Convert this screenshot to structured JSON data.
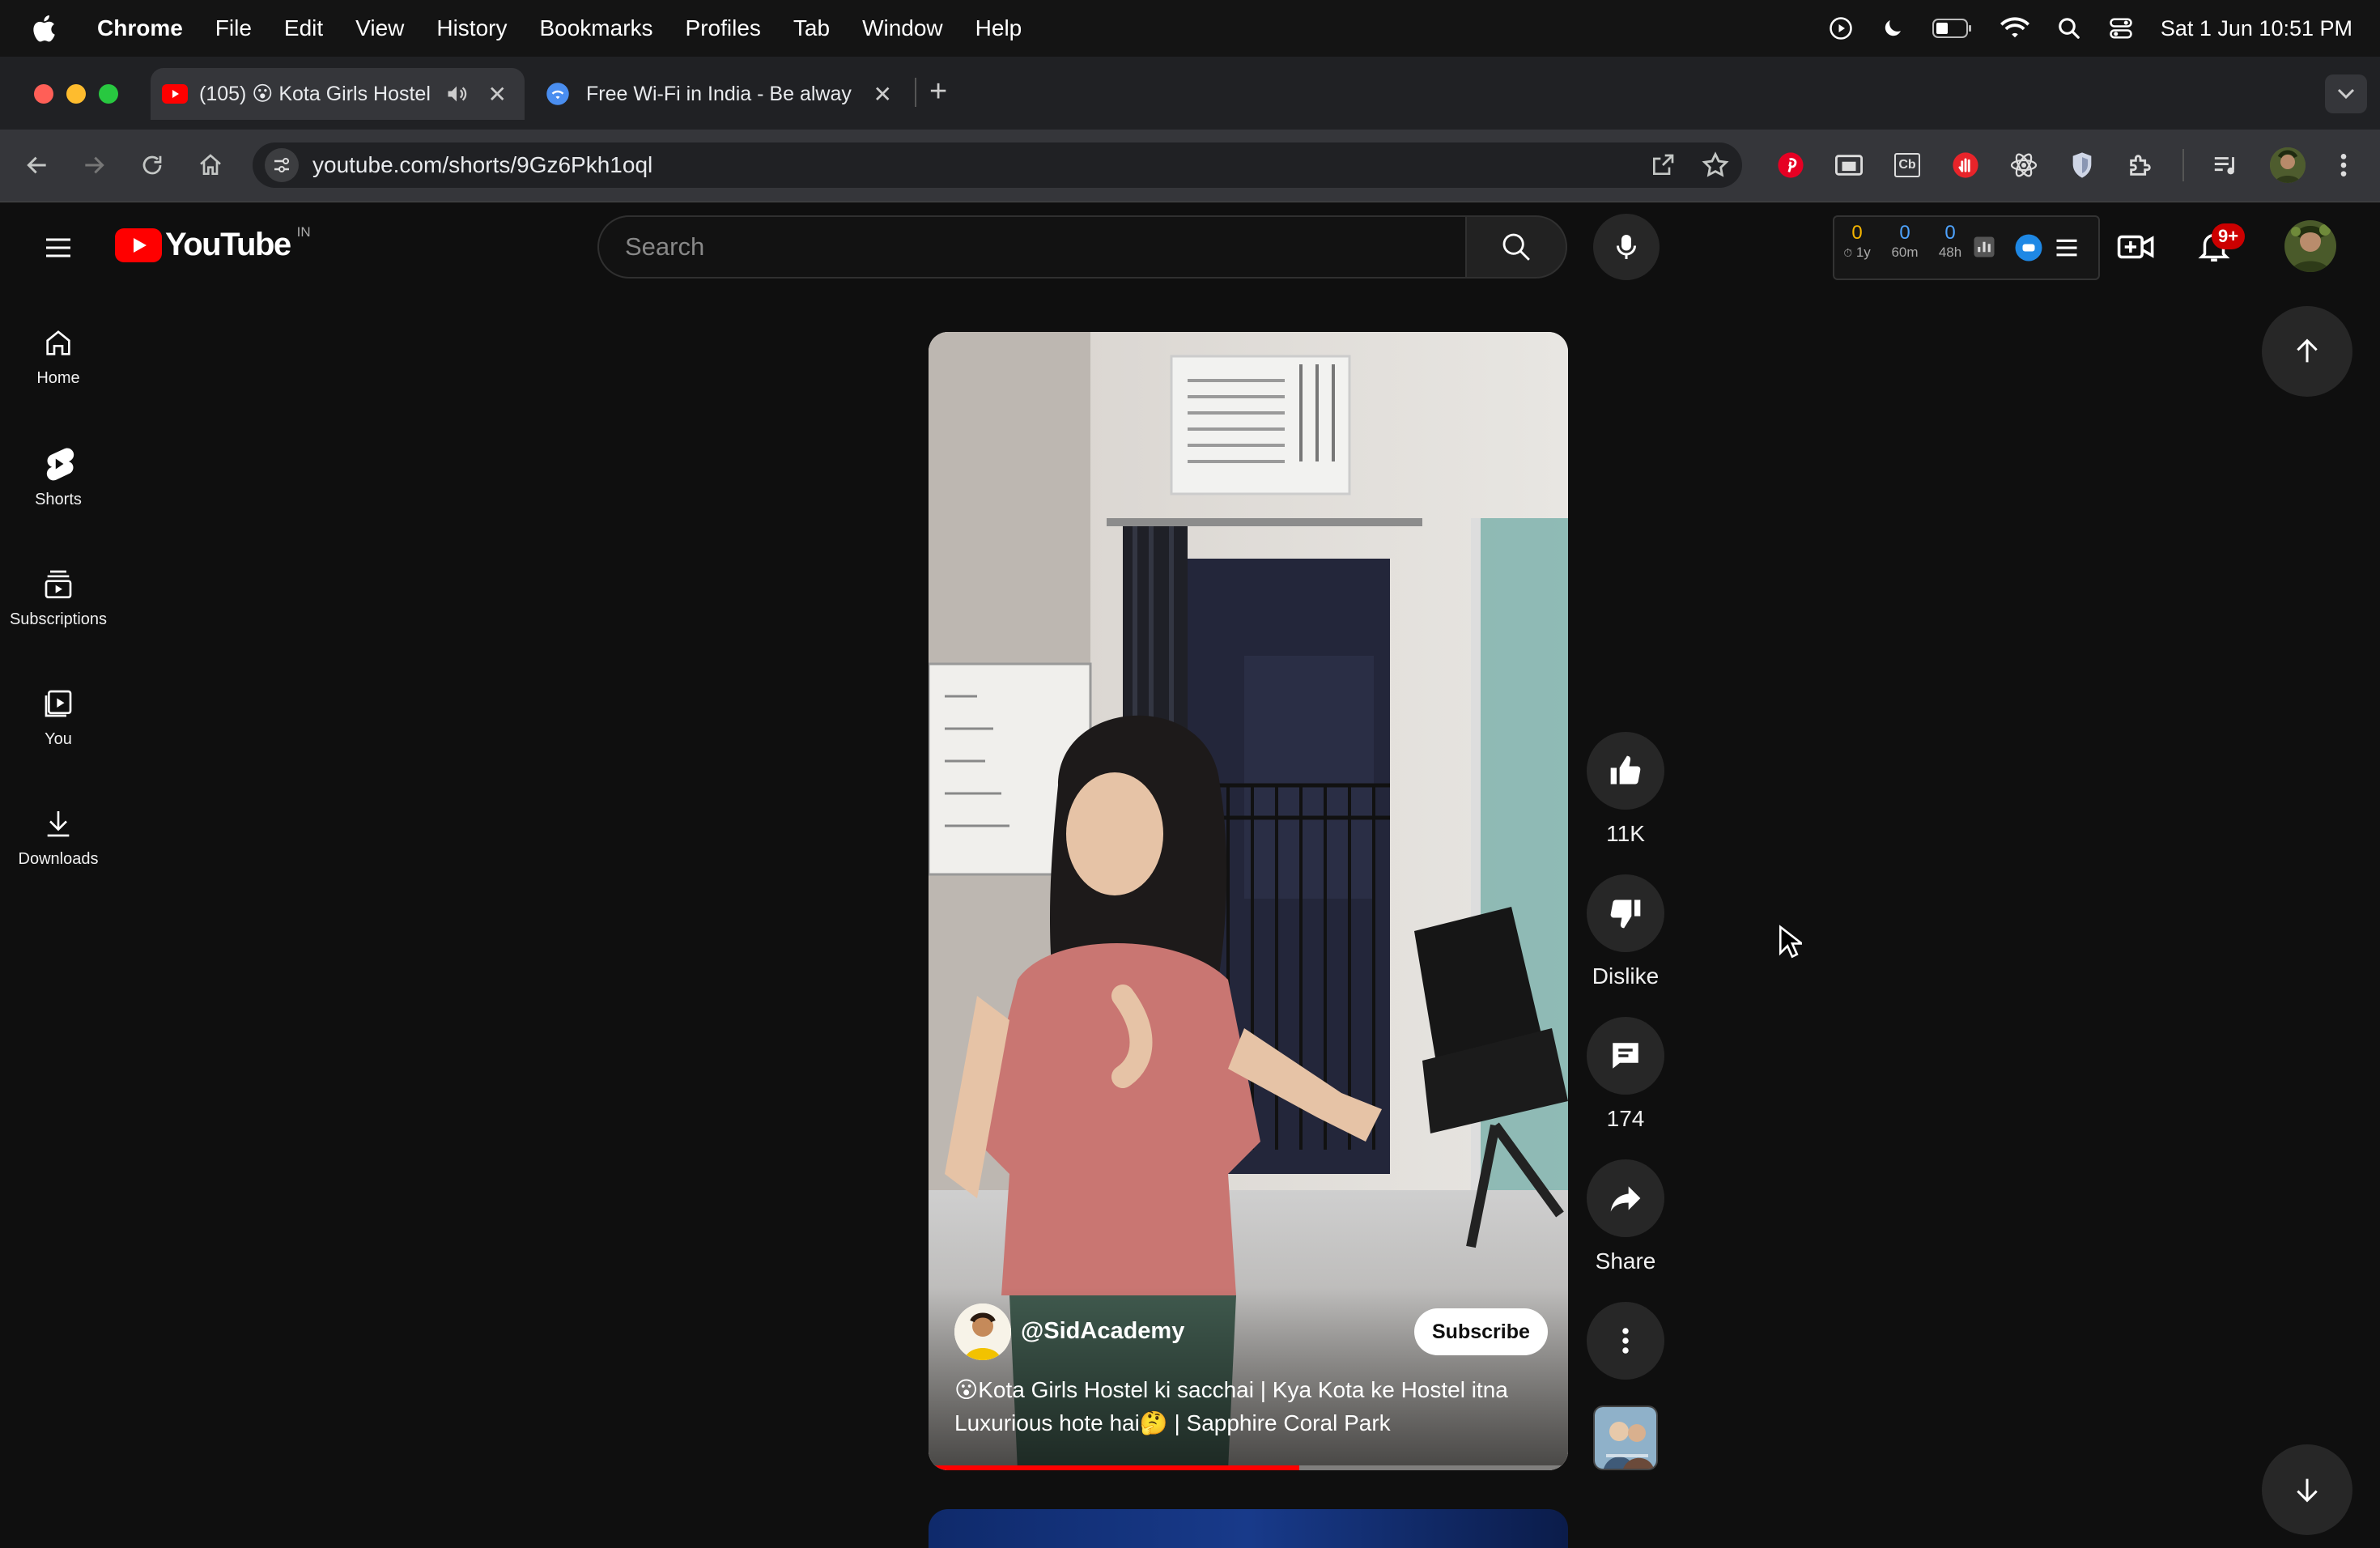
{
  "menubar": {
    "app": "Chrome",
    "items": [
      "File",
      "Edit",
      "View",
      "History",
      "Bookmarks",
      "Profiles",
      "Tab",
      "Window",
      "Help"
    ],
    "clock": "Sat 1 Jun  10:51 PM"
  },
  "tabs": [
    {
      "title": "(105) 😮 Kota Girls Hostel",
      "active": true
    },
    {
      "title": "Free Wi-Fi in India - Be alway",
      "active": false
    }
  ],
  "address": {
    "url": "youtube.com/shorts/9Gz6Pkh1oql"
  },
  "youtube": {
    "logo": "YouTube",
    "country": "IN",
    "search_placeholder": "Search",
    "stats": {
      "v1": "0",
      "l1": "1y",
      "v2": "0",
      "l2": "60m",
      "v3": "0",
      "l3": "48h"
    },
    "notification_badge": "9+"
  },
  "guide": [
    {
      "label": "Home",
      "icon": "home-icon"
    },
    {
      "label": "Shorts",
      "icon": "shorts-icon"
    },
    {
      "label": "Subscriptions",
      "icon": "subscriptions-icon"
    },
    {
      "label": "You",
      "icon": "you-icon"
    },
    {
      "label": "Downloads",
      "icon": "download-icon"
    }
  ],
  "short": {
    "channel": "@SidAcademy",
    "subscribe": "Subscribe",
    "title_line1": "😮Kota Girls Hostel ki sacchai | Kya Kota ke Hostel itna",
    "title_line2": "Luxurious hote hai🤔 | Sapphire Coral Park",
    "progress": 0.58
  },
  "actions": {
    "like": "11K",
    "dislike": "Dislike",
    "comments": "174",
    "share": "Share"
  },
  "colors": {
    "yt_red": "#ff0000",
    "background": "#0f0f0f",
    "chip": "#272727"
  }
}
